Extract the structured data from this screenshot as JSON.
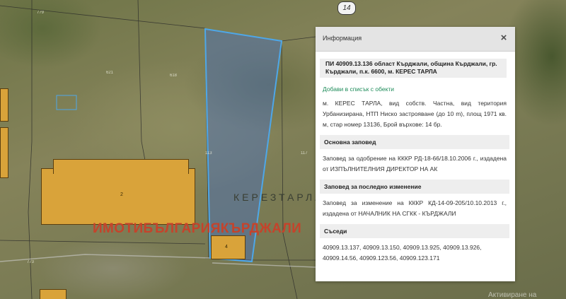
{
  "map": {
    "road_number": "14",
    "locality_label": "КЕРЕЗТАРЛА",
    "watermark": "ИМОТИБЪЛГАРИЯКЪРДЖАЛИ",
    "building_labels": [
      "2",
      "4"
    ],
    "parcel_numbers": [
      "779",
      "621",
      "618",
      "117",
      "113",
      "773"
    ],
    "windows_hint": "Активиране на Windows",
    "colors": {
      "building": "#d9a33a",
      "selected_parcel": "#4ea7e8",
      "watermark": "#c5432b"
    }
  },
  "info_panel": {
    "title": "Информация",
    "close_label": "×",
    "parcel_title": "ПИ 40909.13.136 област Кърджали, община Кърджали, гр. Кърджали, п.к. 6600, м. КЕРЕС ТАРЛА",
    "add_to_list_link": "Добави в списък с обекти",
    "description": "м. КЕРЕС ТАРЛА, вид собств. Частна, вид територия Урбанизирана, НТП Ниско застрояване (до 10 m), площ 1971 кв. м, стар номер 13136, Брой върхове: 14 бр.",
    "sections": [
      {
        "heading": "Основна заповед",
        "text": "Заповед за одобрение на КККР РД-18-66/18.10.2006 г., издадена от ИЗПЪЛНИТЕЛНИЯ ДИРЕКТОР НА АК"
      },
      {
        "heading": "Заповед за последно изменение",
        "text": "Заповед за изменение на КККР КД-14-09-205/10.10.2013 г., издадена от НАЧАЛНИК НА СГКК - КЪРДЖАЛИ"
      },
      {
        "heading": "Съседи",
        "text": "40909.13.137, 40909.13.150, 40909.13.925, 40909.13.926, 40909.14.56, 40909.123.56, 40909.123.171"
      }
    ]
  }
}
